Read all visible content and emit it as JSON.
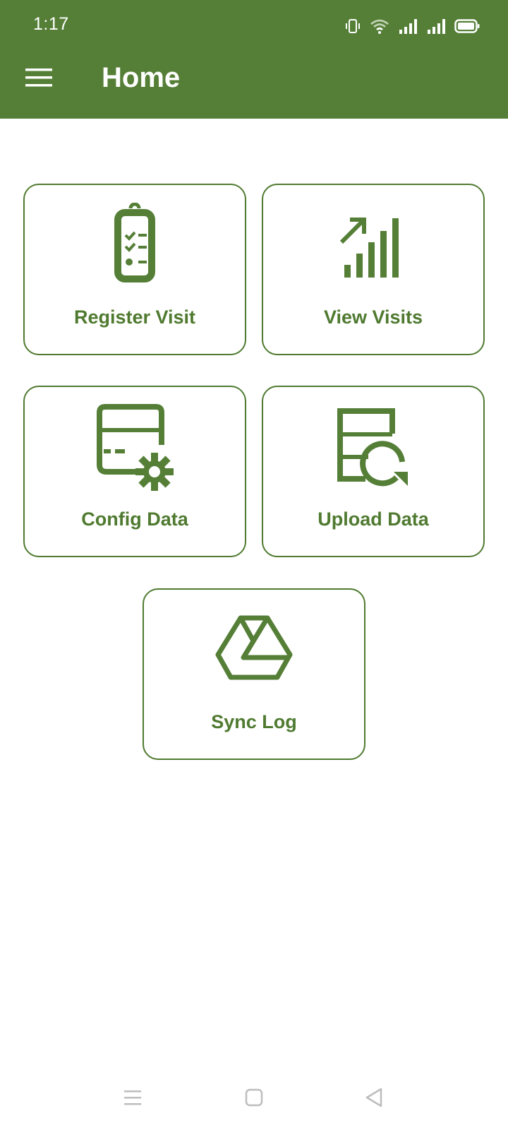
{
  "status_bar": {
    "time": "1:17",
    "icons": [
      "vibrate-icon",
      "wifi-icon",
      "signal-icon",
      "signal-icon",
      "battery-icon"
    ]
  },
  "app_bar": {
    "title": "Home",
    "menu_icon": "hamburger-menu-icon",
    "background": "#557f37"
  },
  "tiles": [
    {
      "label": "Register Visit",
      "icon": "clipboard-checklist-icon"
    },
    {
      "label": "View Visits",
      "icon": "growth-chart-icon"
    },
    {
      "label": "Config Data",
      "icon": "database-settings-icon"
    },
    {
      "label": "Upload Data",
      "icon": "database-refresh-icon"
    },
    {
      "label": "Sync Log",
      "icon": "drive-icon"
    }
  ],
  "accent_color": "#4f7a30",
  "nav_bar": {
    "items": [
      "recents-icon",
      "home-icon",
      "back-icon"
    ]
  }
}
